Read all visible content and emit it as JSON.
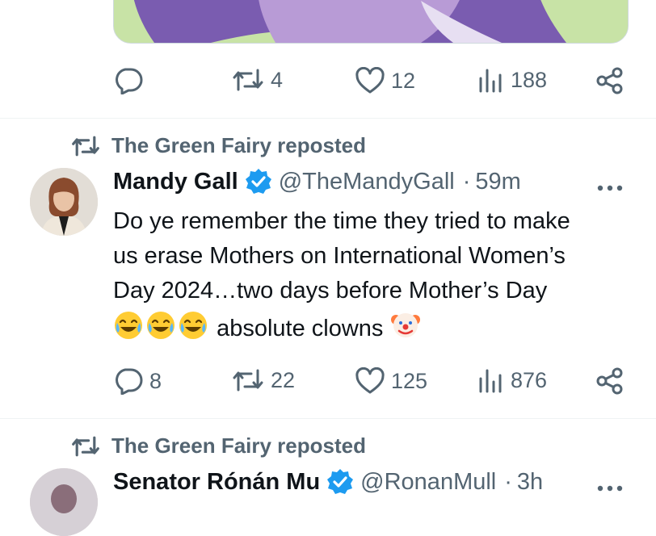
{
  "colors": {
    "accent": "#1d9bf0",
    "muted": "#536471",
    "text": "#0f1419"
  },
  "post1": {
    "actions": {
      "replies": "",
      "reposts": "4",
      "likes": "12",
      "views": "188"
    }
  },
  "post2": {
    "repost_label": "The Green Fairy reposted",
    "name": "Mandy Gall",
    "handle": "@TheMandyGall",
    "separator": "·",
    "time": "59m",
    "text_lines": [
      "Do ye remember the time they tried to make",
      "us erase Mothers on International Women’s",
      "Day 2024…two days before Mother’s Day"
    ],
    "text_last": "absolute clowns",
    "actions": {
      "replies": "8",
      "reposts": "22",
      "likes": "125",
      "views": "876"
    }
  },
  "post3": {
    "repost_label": "The Green Fairy reposted",
    "name": "Senator Rónán Mu",
    "handle": "@RonanMull",
    "time": "3h"
  },
  "icons": {
    "reply": "reply-icon",
    "repost": "repost-icon",
    "like": "heart-icon",
    "views": "views-icon",
    "share": "share-icon",
    "verified": "verified-badge-icon",
    "more": "more-icon"
  }
}
